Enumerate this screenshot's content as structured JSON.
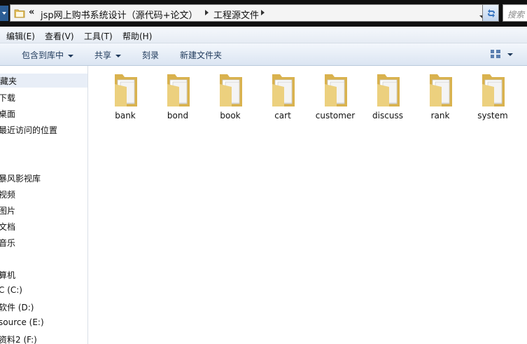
{
  "address": {
    "overflow_chevron": "«",
    "crumbs": [
      "jsp网上购书系统设计（源代码+论文）",
      "工程源文件"
    ],
    "search_placeholder": "搜索"
  },
  "menu": [
    "编辑(E)",
    "查看(V)",
    "工具(T)",
    "帮助(H)"
  ],
  "commands": {
    "include_library": "包含到库中",
    "share": "共享",
    "burn": "刻录",
    "new_folder": "新建文件夹"
  },
  "nav": {
    "favorites": [
      "藏夹",
      "下载",
      "桌面",
      "最近访问的位置"
    ],
    "libraries": [
      "暴风影视库",
      "视频",
      "图片",
      "文档",
      "音乐"
    ],
    "computer": [
      "算机",
      "C (C:)",
      "软件 (D:)",
      "source (E:)",
      "资料2 (F:)"
    ]
  },
  "folders": [
    "bank",
    "bond",
    "book",
    "cart",
    "customer",
    "discuss",
    "rank",
    "system"
  ],
  "colors": {
    "folder_body": "#e8c66a",
    "selection": "#e8eef7",
    "command_text": "#1e395b"
  }
}
